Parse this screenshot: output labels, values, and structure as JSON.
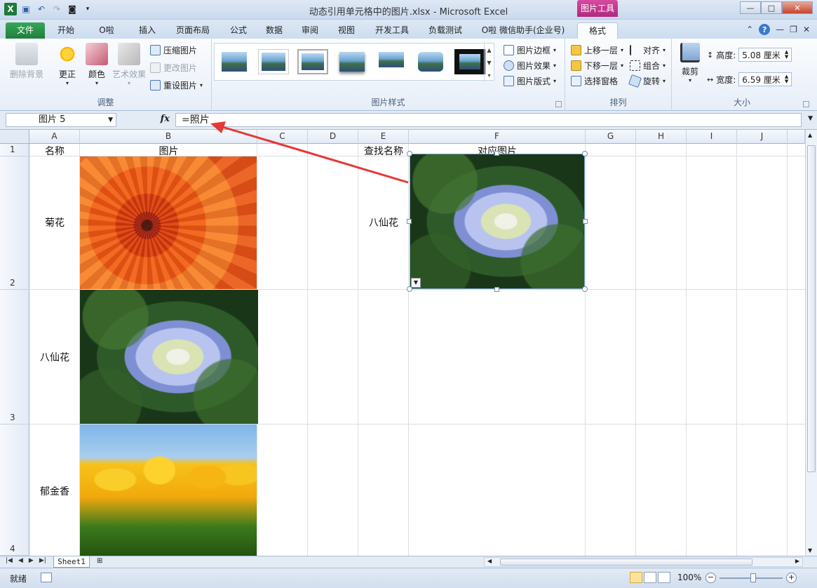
{
  "window": {
    "title": "动态引用单元格中的图片.xlsx - Microsoft Excel",
    "contextual_tab_group": "图片工具"
  },
  "qat": {
    "app_icon": "excel-icon",
    "save_icon": "save-icon",
    "undo_icon": "undo-icon",
    "redo_icon": "redo-icon",
    "camera_icon": "camera-icon"
  },
  "tabs": [
    {
      "label": "文件"
    },
    {
      "label": "开始"
    },
    {
      "label": "O啦"
    },
    {
      "label": "插入"
    },
    {
      "label": "页面布局"
    },
    {
      "label": "公式"
    },
    {
      "label": "数据"
    },
    {
      "label": "审阅"
    },
    {
      "label": "视图"
    },
    {
      "label": "开发工具"
    },
    {
      "label": "负载测试"
    },
    {
      "label": "O啦 微信助手(企业号)"
    },
    {
      "label": "格式"
    }
  ],
  "ribbon": {
    "adjust": {
      "label": "调整",
      "remove_bg": "删除背景",
      "corrections": "更正",
      "color": "颜色",
      "artistic": "艺术效果",
      "compress": "压缩图片",
      "change": "更改图片",
      "reset": "重设图片"
    },
    "styles": {
      "label": "图片样式",
      "border": "图片边框",
      "effects": "图片效果",
      "layout": "图片版式"
    },
    "arrange": {
      "label": "排列",
      "bring_forward": "上移一层",
      "send_backward": "下移一层",
      "selection_pane": "选择窗格",
      "align": "对齐",
      "group": "组合",
      "rotate": "旋转"
    },
    "size": {
      "label": "大小",
      "crop": "裁剪",
      "height_label": "高度:",
      "height_value": "5.08 厘米",
      "width_label": "宽度:",
      "width_value": "6.59 厘米"
    }
  },
  "formula_bar": {
    "name_box": "图片 5",
    "fx": "fx",
    "formula": "=照片"
  },
  "columns": [
    "A",
    "B",
    "C",
    "D",
    "E",
    "F",
    "G",
    "H",
    "I",
    "J"
  ],
  "rows": [
    "1",
    "2",
    "3",
    "4"
  ],
  "cells": {
    "A1": "名称",
    "B1": "图片",
    "E1": "查找名称",
    "F1": "对应图片",
    "A2": "菊花",
    "A3": "八仙花",
    "A4": "郁金香",
    "E2": "八仙花"
  },
  "sheets": {
    "active": "Sheet1"
  },
  "status": {
    "ready": "就绪",
    "zoom": "100%"
  },
  "colors": {
    "file_tab": "#1f7e3b",
    "contextual_tab": "#b02a7f",
    "annotation_arrow": "#e53935"
  }
}
